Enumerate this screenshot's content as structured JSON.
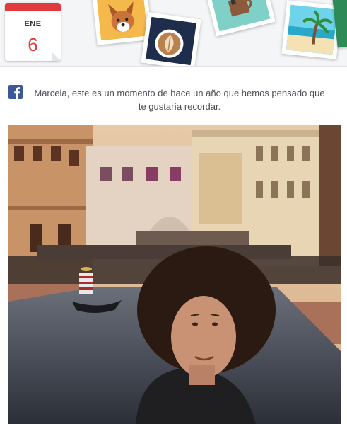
{
  "calendar": {
    "month": "ENE",
    "day": "6"
  },
  "stickers": [
    "dog-photo-sticker",
    "latte-art-sticker",
    "cup-sticker",
    "beach-palm-sticker"
  ],
  "post": {
    "message": "Marcela, este es un momento de hace un año que hemos pensado que te gustaría recordar.",
    "icon": "facebook-icon"
  },
  "colors": {
    "facebook_blue": "#3b5998",
    "calendar_red": "#e0393e",
    "text": "#4b4f56"
  }
}
